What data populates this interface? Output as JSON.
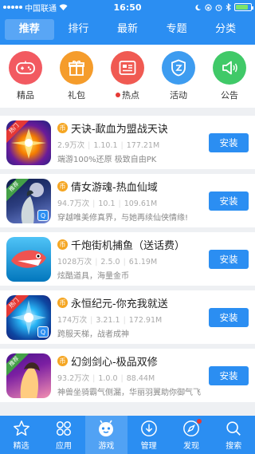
{
  "status_bar": {
    "carrier": "中国联通",
    "time": "16:50"
  },
  "tabs": [
    {
      "label": "推荐"
    },
    {
      "label": "排行"
    },
    {
      "label": "最新"
    },
    {
      "label": "专题"
    },
    {
      "label": "分类"
    }
  ],
  "categories": [
    {
      "label": "精品",
      "color": "#f25a61"
    },
    {
      "label": "礼包",
      "color": "#f59c2b"
    },
    {
      "label": "热点",
      "color": "#f05a52"
    },
    {
      "label": "活动",
      "color": "#3d9cf0"
    },
    {
      "label": "公告",
      "color": "#40c968"
    }
  ],
  "apps": [
    {
      "title": "天诀-歃血为盟战天诀",
      "downloads": "2.9万次",
      "version": "1.10.1",
      "size": "177.21M",
      "desc": "端游100%还原 极致自由PK",
      "ribbon": "热门",
      "ribbon_color": "#e53935",
      "install_label": "安装"
    },
    {
      "title": "倩女游魂-热血仙域",
      "downloads": "94.7万次",
      "version": "10.1",
      "size": "109.61M",
      "desc": "穿越唯美修真界，与她再续仙侠情缘!",
      "ribbon": "推荐",
      "ribbon_color": "#43a047",
      "install_label": "安装"
    },
    {
      "title": "千炮街机捕鱼（送话费）",
      "downloads": "1028万次",
      "version": "2.5.0",
      "size": "61.19M",
      "desc": "炫酷道具，海量金币",
      "ribbon": "",
      "ribbon_color": "",
      "install_label": "安装"
    },
    {
      "title": "永恒纪元-你充我就送",
      "downloads": "174万次",
      "version": "3.21.1",
      "size": "172.91M",
      "desc": "跨服天梯，战者成神",
      "ribbon": "热门",
      "ribbon_color": "#e53935",
      "install_label": "安装"
    },
    {
      "title": "幻剑剑心-极品双修",
      "downloads": "93.2万次",
      "version": "1.0.0",
      "size": "88.44M",
      "desc": "神兽坐骑霸气侧漏，华丽羽翼助你御气飞",
      "ribbon": "推荐",
      "ribbon_color": "#43a047",
      "install_label": "安装"
    }
  ],
  "bottom_nav": [
    {
      "label": "精选"
    },
    {
      "label": "应用"
    },
    {
      "label": "游戏"
    },
    {
      "label": "管理"
    },
    {
      "label": "发现"
    },
    {
      "label": "搜索"
    }
  ]
}
